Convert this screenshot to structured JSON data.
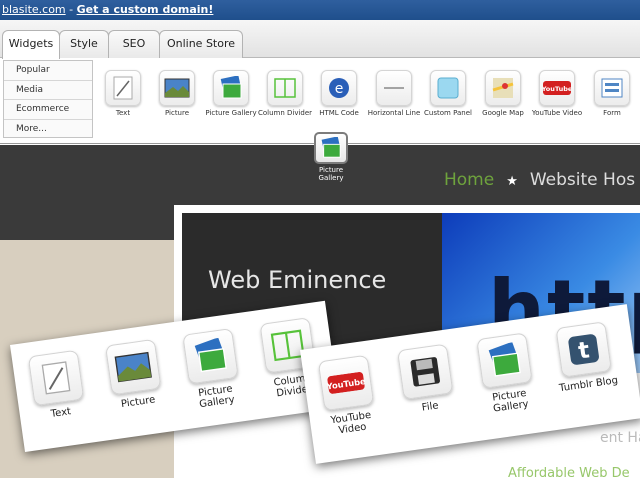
{
  "topbar": {
    "site_text": "blasite.com",
    "separator": " - ",
    "custom_domain": "Get a custom domain!"
  },
  "tabs": [
    {
      "label": "Widgets"
    },
    {
      "label": "Style"
    },
    {
      "label": "SEO"
    },
    {
      "label": "Online Store"
    }
  ],
  "categories": [
    "Popular",
    "Media",
    "Ecommerce",
    "More..."
  ],
  "widgets": [
    {
      "label": "Text",
      "icon": "text-icon"
    },
    {
      "label": "Picture",
      "icon": "picture-icon"
    },
    {
      "label": "Picture Gallery",
      "icon": "picture-gallery-icon"
    },
    {
      "label": "Column Divider",
      "icon": "column-divider-icon"
    },
    {
      "label": "HTML Code",
      "icon": "html-code-icon"
    },
    {
      "label": "Horizontal Line",
      "icon": "horizontal-line-icon"
    },
    {
      "label": "Custom Panel",
      "icon": "custom-panel-icon"
    },
    {
      "label": "Google Map",
      "icon": "google-map-icon"
    },
    {
      "label": "YouTube Video",
      "icon": "youtube-icon"
    },
    {
      "label": "Form",
      "icon": "form-icon"
    }
  ],
  "dragging": {
    "label": "Picture Gallery"
  },
  "site": {
    "nav_home": "Home",
    "nav_star": "★",
    "nav_second": "Website Hos",
    "brand": "Web Eminence",
    "photo_text": "http",
    "affordable": "Affordable Web De",
    "partial": "ent Ha"
  },
  "zoom_left": [
    {
      "label": "Text"
    },
    {
      "label": "Picture"
    },
    {
      "label": "Picture Gallery"
    },
    {
      "label": "Column Divider"
    }
  ],
  "zoom_right": [
    {
      "label": "YouTube Video"
    },
    {
      "label": "File"
    },
    {
      "label": "Picture Gallery"
    },
    {
      "label": "Tumblr Blog"
    }
  ],
  "icon_text": {
    "youtube": "YouTube",
    "tumblr": "t",
    "html": "e"
  },
  "colors": {
    "topbar": "#2a5a9a",
    "nav_home": "#6ea33d",
    "affordable": "#97c76a",
    "dark_bg": "#3a3a3a"
  }
}
